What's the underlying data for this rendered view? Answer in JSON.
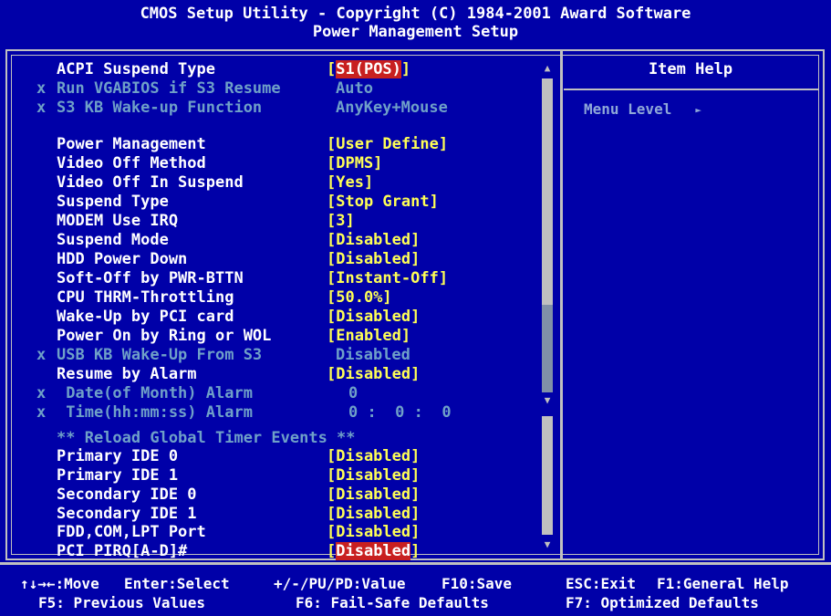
{
  "header": {
    "line1": "CMOS Setup Utility - Copyright (C) 1984-2001 Award Software",
    "line2": "Power Management Setup"
  },
  "help": {
    "title": "Item Help",
    "menu_level": "Menu Level",
    "menu_level_arrow": "►"
  },
  "items": [
    {
      "label": "ACPI Suspend Type",
      "value": "S1(POS)",
      "disabled": false,
      "selected": true
    },
    {
      "label": "Run VGABIOS if S3 Resume",
      "value": "Auto",
      "disabled": true
    },
    {
      "label": "S3 KB Wake-up Function",
      "value": "AnyKey+Mouse",
      "disabled": true
    },
    {
      "label": "Power Management",
      "value": "[User Define]"
    },
    {
      "label": "Video Off Method",
      "value": "[DPMS]"
    },
    {
      "label": "Video Off In Suspend",
      "value": "[Yes]"
    },
    {
      "label": "Suspend Type",
      "value": "[Stop Grant]"
    },
    {
      "label": "MODEM Use IRQ",
      "value": "[3]"
    },
    {
      "label": "Suspend Mode",
      "value": "[Disabled]"
    },
    {
      "label": "HDD Power Down",
      "value": "[Disabled]"
    },
    {
      "label": "Soft-Off by PWR-BTTN",
      "value": "[Instant-Off]"
    },
    {
      "label": "CPU THRM-Throttling",
      "value": "[50.0%]"
    },
    {
      "label": "Wake-Up by PCI card",
      "value": "[Disabled]"
    },
    {
      "label": "Power On by Ring or WOL",
      "value": "[Enabled]"
    },
    {
      "label": "USB KB Wake-Up From S3",
      "value": "Disabled",
      "disabled": true
    },
    {
      "label": "Resume by Alarm",
      "value": "[Disabled]"
    },
    {
      "label": " Date(of Month) Alarm",
      "value": "0",
      "disabled": true
    },
    {
      "label": " Time(hh:mm:ss) Alarm",
      "value": "0 :  0 :  0",
      "disabled": true
    },
    {
      "label": "** Reload Global Timer Events **",
      "value": "",
      "disabled": true
    },
    {
      "label": "Primary IDE 0",
      "value": "[Disabled]"
    },
    {
      "label": "Primary IDE 1",
      "value": "[Disabled]"
    },
    {
      "label": "Secondary IDE 0",
      "value": "[Disabled]"
    },
    {
      "label": "Secondary IDE 1",
      "value": "[Disabled]"
    },
    {
      "label": "FDD,COM,LPT Port",
      "value": "[Disabled]"
    },
    {
      "label": "PCI PIRQ[A-D]#",
      "value": "Disabled",
      "selected": true
    }
  ],
  "acpi": {
    "open": "[",
    "value": "S1(POS)",
    "close": "]"
  },
  "pci": {
    "open": "[",
    "value": "Disabled",
    "close": "]"
  },
  "x_mark": "x",
  "footer": {
    "move": "↑↓→←:Move",
    "enter": "Enter:Select",
    "value": "+/-/PU/PD:Value",
    "save": "F10:Save",
    "esc": "ESC:Exit",
    "help": "F1:General Help",
    "f5": "F5: Previous Values",
    "f6": "F6: Fail-Safe Defaults",
    "f7": "F7: Optimized Defaults"
  },
  "scroll_up": "▲",
  "scroll_down": "▼"
}
